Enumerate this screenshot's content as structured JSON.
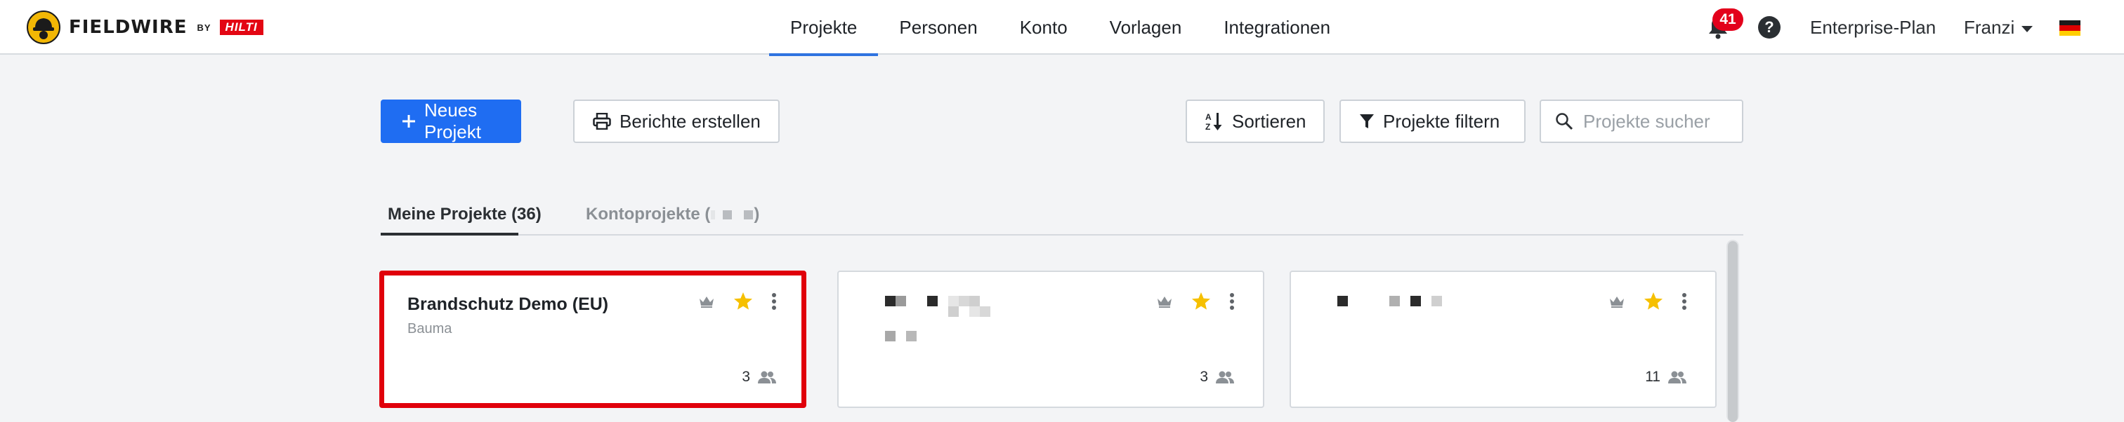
{
  "header": {
    "logo_word": "FIELDWIRE",
    "logo_by": "BY",
    "logo_brand": "HILTI",
    "nav": [
      {
        "label": "Projekte",
        "active": true
      },
      {
        "label": "Personen",
        "active": false
      },
      {
        "label": "Konto",
        "active": false
      },
      {
        "label": "Vorlagen",
        "active": false
      },
      {
        "label": "Integrationen",
        "active": false
      }
    ],
    "notifications_count": "41",
    "help_symbol": "?",
    "plan_label": "Enterprise-Plan",
    "user_name": "Franzi",
    "locale_flag": "german-flag-icon"
  },
  "toolbar": {
    "new_project_label": "Neues Projekt",
    "reports_label": "Berichte erstellen",
    "sort_label": "Sortieren",
    "filter_label": "Projekte filtern",
    "search_placeholder": "Projekte sucher"
  },
  "tabs": {
    "mine_label": "Meine Projekte (36)",
    "account_label_prefix": "Kontoprojekte (",
    "account_label_suffix": ")"
  },
  "cards": [
    {
      "title": "Brandschutz Demo (EU)",
      "subtitle": "Bauma",
      "members": "3",
      "starred": true,
      "highlighted": true
    },
    {
      "title": "",
      "subtitle": "",
      "members": "3",
      "starred": true,
      "highlighted": false
    },
    {
      "title": "",
      "subtitle": "",
      "members": "11",
      "starred": true,
      "highlighted": false
    }
  ],
  "colors": {
    "primary": "#1f6df2",
    "nav_active_underline": "#2f73e0",
    "badge_red": "#e3001b",
    "highlight_red": "#e0000b",
    "star": "#f6c000"
  }
}
